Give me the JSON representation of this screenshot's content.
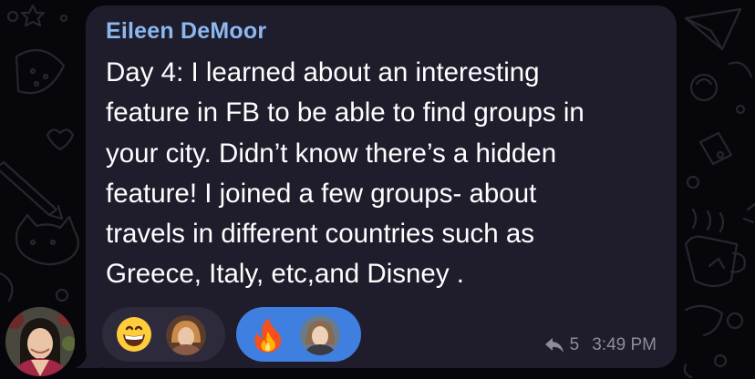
{
  "chat": {
    "wallpaper_color": "#07070b",
    "message": {
      "sender": "Eileen DeMoor",
      "lines": [
        "Day 4: I learned about an interesting",
        "feature in FB to be able to find groups in",
        "your city. Didn’t know there’s a hidden",
        "feature! I joined a few groups- about",
        "travels in different countries such as",
        "Greece, Italy, etc,and Disney ."
      ],
      "bubble_color": "#1f1d2c",
      "sender_color": "#8cb8f2",
      "reactions": [
        {
          "emoji": "grinning-face",
          "active": false
        },
        {
          "emoji": "fire",
          "active": true
        }
      ],
      "reply_count": "5",
      "time": "3:49 PM"
    }
  }
}
